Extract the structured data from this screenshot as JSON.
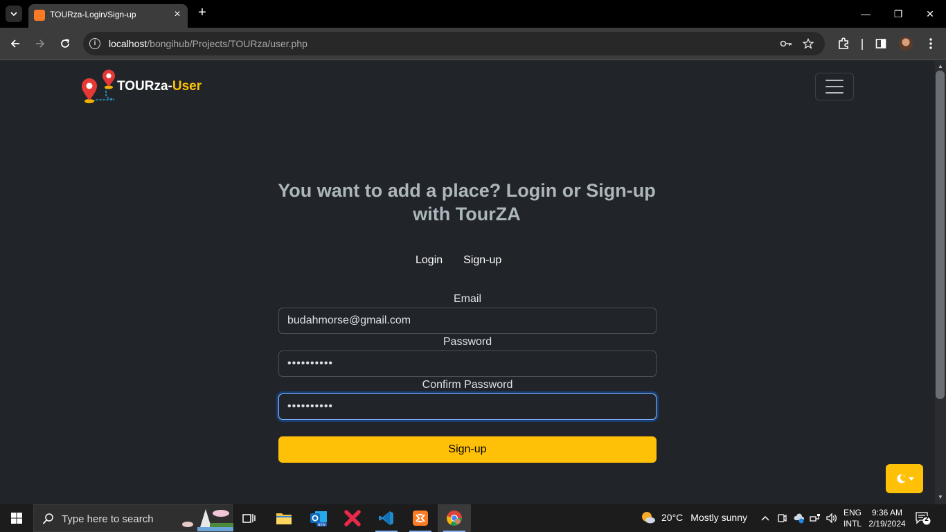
{
  "browser": {
    "tab_title": "TOURza-Login/Sign-up",
    "url_host": "localhost",
    "url_path": "/bongihub/Projects/TOURza/user.php"
  },
  "page": {
    "brand_main": "TOURza-",
    "brand_accent": "User",
    "headline": "You want to add a place? Login or Sign-up with TourZA",
    "tabs": [
      "Login",
      "Sign-up"
    ],
    "form": {
      "email_label": "Email",
      "email_value": "budahmorse@gmail.com",
      "password_label": "Password",
      "password_value": "••••••••••",
      "confirm_label": "Confirm Password",
      "confirm_value": "••••••••••",
      "submit_label": "Sign-up"
    }
  },
  "taskbar": {
    "search_placeholder": "Type here to search",
    "weather_temp": "20°C",
    "weather_desc": "Mostly sunny",
    "lang_line1": "ENG",
    "lang_line2": "INTL",
    "time": "9:36 AM",
    "date": "2/19/2024",
    "notification_count": "2"
  },
  "colors": {
    "accent": "#ffc107",
    "page_bg": "#212529",
    "headline": "#adb5bd"
  }
}
